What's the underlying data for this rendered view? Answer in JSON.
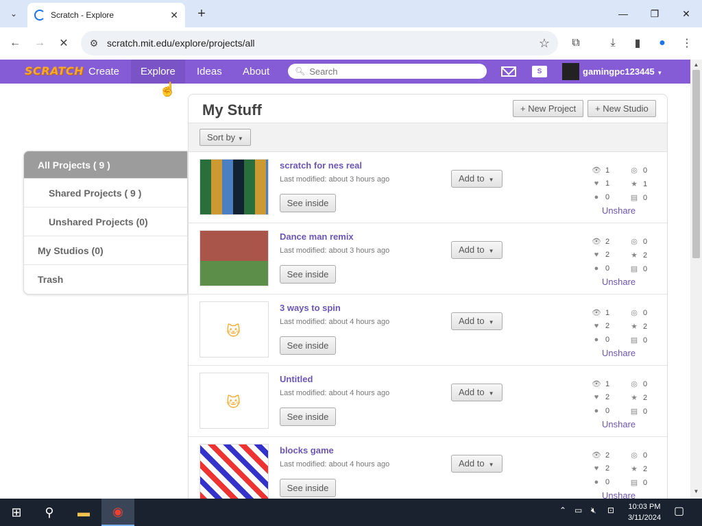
{
  "browser": {
    "tab_title": "Scratch - Explore",
    "url": "scratch.mit.edu/explore/projects/all"
  },
  "nav": {
    "logo": "SCRATCH",
    "links": [
      "Create",
      "Explore",
      "Ideas",
      "About"
    ],
    "active": "Explore",
    "search_placeholder": "Search",
    "username": "gamingpc123445"
  },
  "sidebar": {
    "items": [
      {
        "label": "All Projects ( 9 )",
        "active": true,
        "sub": false
      },
      {
        "label": "Shared Projects ( 9 )",
        "active": false,
        "sub": true
      },
      {
        "label": "Unshared Projects (0)",
        "active": false,
        "sub": true
      },
      {
        "label": "My Studios (0)",
        "active": false,
        "sub": false
      },
      {
        "label": "Trash",
        "active": false,
        "sub": false
      }
    ]
  },
  "main": {
    "title": "My Stuff",
    "new_project": "+ New Project",
    "new_studio": "+ New Studio",
    "sort_by": "Sort by",
    "see_inside": "See inside",
    "add_to": "Add to",
    "unshare": "Unshare",
    "projects": [
      {
        "title": "scratch for nes real",
        "modified": "Last modified: about 3 hours ago",
        "views": "1",
        "loves": "1",
        "comments": "0",
        "remixes": "0",
        "favorites": "1",
        "studios": "0"
      },
      {
        "title": "Dance man remix",
        "modified": "Last modified: about 3 hours ago",
        "views": "2",
        "loves": "2",
        "comments": "0",
        "remixes": "0",
        "favorites": "2",
        "studios": "0"
      },
      {
        "title": "3 ways to spin",
        "modified": "Last modified: about 4 hours ago",
        "views": "1",
        "loves": "2",
        "comments": "0",
        "remixes": "0",
        "favorites": "2",
        "studios": "0"
      },
      {
        "title": "Untitled",
        "modified": "Last modified: about 4 hours ago",
        "views": "1",
        "loves": "2",
        "comments": "0",
        "remixes": "0",
        "favorites": "2",
        "studios": "0"
      },
      {
        "title": "blocks game",
        "modified": "Last modified: about 4 hours ago",
        "views": "2",
        "loves": "2",
        "comments": "0",
        "remixes": "0",
        "favorites": "2",
        "studios": "0"
      }
    ]
  },
  "taskbar": {
    "time": "10:03 PM",
    "date": "3/11/2024"
  },
  "colors": {
    "scratch_purple": "#855cd6",
    "link_purple": "#6b55b5"
  }
}
